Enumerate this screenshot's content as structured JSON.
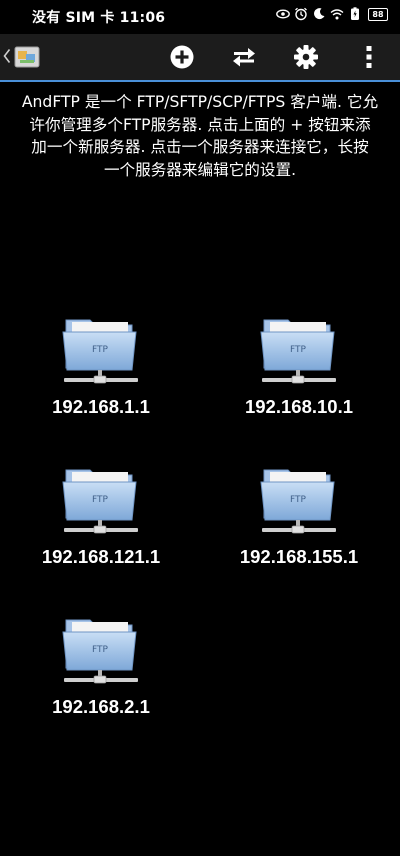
{
  "status_bar": {
    "carrier_time": "没有 SIM 卡 11:06",
    "icons": [
      "eye-icon",
      "alarm-icon",
      "dnd-icon",
      "wifi-icon",
      "battery-saver-icon"
    ],
    "battery": "88"
  },
  "action_bar": {
    "icons": [
      "back-chevron-icon",
      "app-logo-icon",
      "add-circle-icon",
      "transfer-arrows-icon",
      "gear-icon",
      "overflow-menu-icon"
    ]
  },
  "intro": {
    "lines": [
      "AndFTP 是一个 FTP/SFTP/SCP/FTPS 客户端. 它允",
      "许你管理多个FTP服务器. 点击上面的 + 按钮来添",
      "加一个新服务器. 点击一个服务器来连接它，长按",
      "一个服务器来编辑它的设置."
    ]
  },
  "servers": [
    {
      "label": "192.168.1.1",
      "icon_text": "FTP"
    },
    {
      "label": "192.168.10.1",
      "icon_text": "FTP"
    },
    {
      "label": "192.168.121.1",
      "icon_text": "FTP"
    },
    {
      "label": "192.168.155.1",
      "icon_text": "FTP"
    },
    {
      "label": "192.168.2.1",
      "icon_text": "FTP"
    }
  ],
  "colors": {
    "background": "#000000",
    "action_bar": "#1c1c1c",
    "accent_line": "#4a90d9",
    "folder_light": "#c9def5",
    "folder_dark": "#7ea8d8"
  }
}
